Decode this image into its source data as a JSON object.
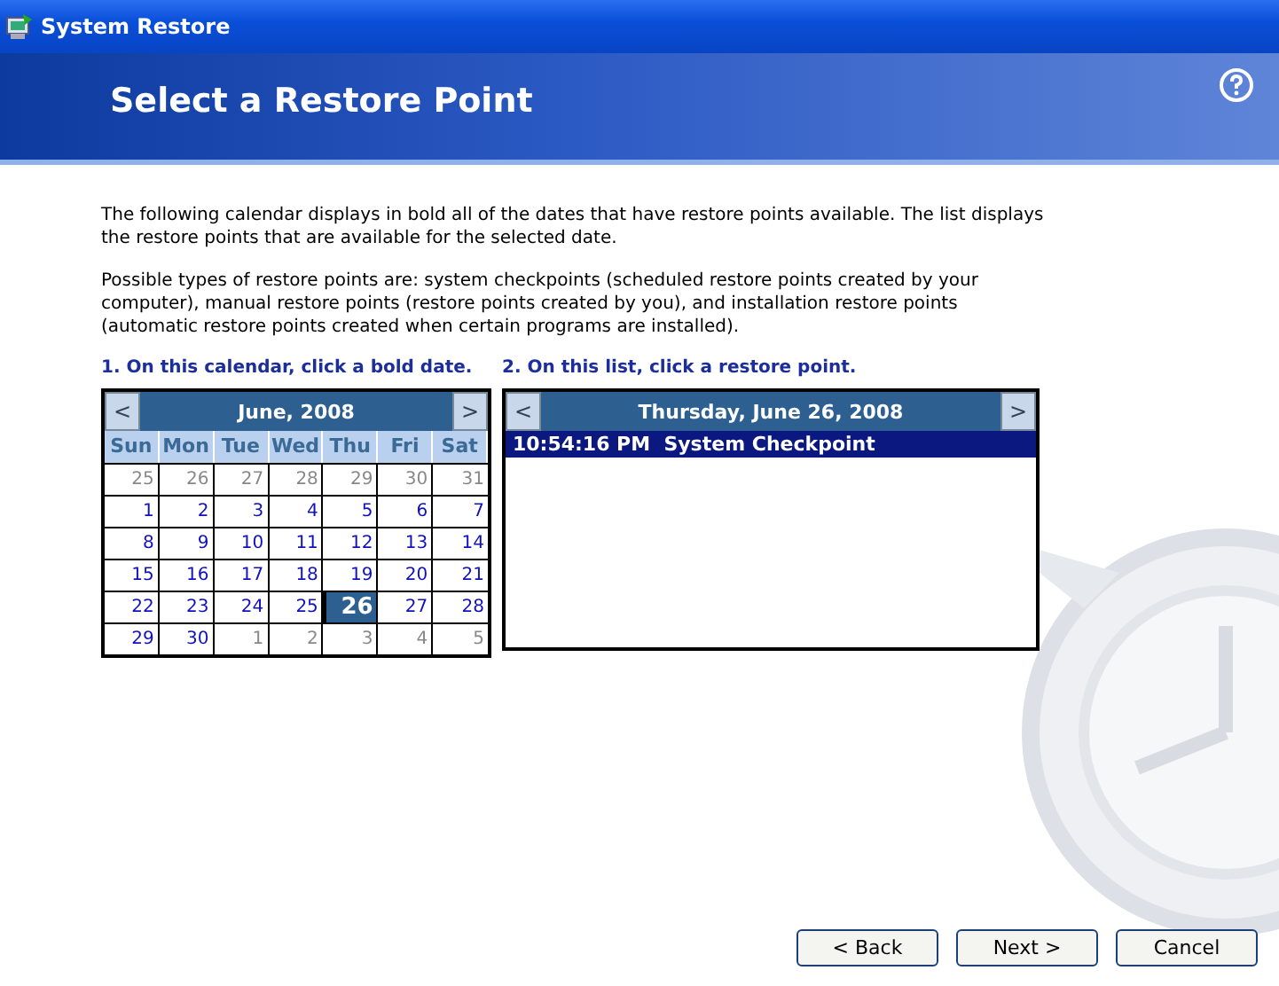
{
  "window": {
    "title": "System Restore"
  },
  "header": {
    "title": "Select a Restore Point"
  },
  "intro": [
    "The following calendar displays in bold all of the dates that have restore points available. The list displays the restore points that are available for the selected date.",
    "Possible types of restore points are: system checkpoints (scheduled restore points created by your computer), manual restore points (restore points created by you), and installation restore points (automatic restore points created when certain programs are installed)."
  ],
  "calendar": {
    "instruction": "1. On this calendar, click a bold date.",
    "prev": "<",
    "next": ">",
    "month": "June, 2008",
    "weekdays": [
      "Sun",
      "Mon",
      "Tue",
      "Wed",
      "Thu",
      "Fri",
      "Sat"
    ],
    "weeks": [
      [
        {
          "day": "25",
          "current": false,
          "selected": false
        },
        {
          "day": "26",
          "current": false,
          "selected": false
        },
        {
          "day": "27",
          "current": false,
          "selected": false
        },
        {
          "day": "28",
          "current": false,
          "selected": false
        },
        {
          "day": "29",
          "current": false,
          "selected": false
        },
        {
          "day": "30",
          "current": false,
          "selected": false
        },
        {
          "day": "31",
          "current": false,
          "selected": false
        }
      ],
      [
        {
          "day": "1",
          "current": true,
          "selected": false
        },
        {
          "day": "2",
          "current": true,
          "selected": false
        },
        {
          "day": "3",
          "current": true,
          "selected": false
        },
        {
          "day": "4",
          "current": true,
          "selected": false
        },
        {
          "day": "5",
          "current": true,
          "selected": false
        },
        {
          "day": "6",
          "current": true,
          "selected": false
        },
        {
          "day": "7",
          "current": true,
          "selected": false
        }
      ],
      [
        {
          "day": "8",
          "current": true,
          "selected": false
        },
        {
          "day": "9",
          "current": true,
          "selected": false
        },
        {
          "day": "10",
          "current": true,
          "selected": false
        },
        {
          "day": "11",
          "current": true,
          "selected": false
        },
        {
          "day": "12",
          "current": true,
          "selected": false
        },
        {
          "day": "13",
          "current": true,
          "selected": false
        },
        {
          "day": "14",
          "current": true,
          "selected": false
        }
      ],
      [
        {
          "day": "15",
          "current": true,
          "selected": false
        },
        {
          "day": "16",
          "current": true,
          "selected": false
        },
        {
          "day": "17",
          "current": true,
          "selected": false
        },
        {
          "day": "18",
          "current": true,
          "selected": false
        },
        {
          "day": "19",
          "current": true,
          "selected": false
        },
        {
          "day": "20",
          "current": true,
          "selected": false
        },
        {
          "day": "21",
          "current": true,
          "selected": false
        }
      ],
      [
        {
          "day": "22",
          "current": true,
          "selected": false
        },
        {
          "day": "23",
          "current": true,
          "selected": false
        },
        {
          "day": "24",
          "current": true,
          "selected": false
        },
        {
          "day": "25",
          "current": true,
          "selected": false
        },
        {
          "day": "26",
          "current": true,
          "selected": true
        },
        {
          "day": "27",
          "current": true,
          "selected": false
        },
        {
          "day": "28",
          "current": true,
          "selected": false
        }
      ],
      [
        {
          "day": "29",
          "current": true,
          "selected": false
        },
        {
          "day": "30",
          "current": true,
          "selected": false
        },
        {
          "day": "1",
          "current": false,
          "selected": false
        },
        {
          "day": "2",
          "current": false,
          "selected": false
        },
        {
          "day": "3",
          "current": false,
          "selected": false
        },
        {
          "day": "4",
          "current": false,
          "selected": false
        },
        {
          "day": "5",
          "current": false,
          "selected": false
        }
      ]
    ]
  },
  "list": {
    "instruction": "2. On this list, click a restore point.",
    "prev": "<",
    "next": ">",
    "date": "Thursday, June 26, 2008",
    "items": [
      {
        "time": "10:54:16 PM",
        "name": "System Checkpoint",
        "selected": true
      }
    ]
  },
  "buttons": [
    "< Back",
    "Next >",
    "Cancel"
  ]
}
